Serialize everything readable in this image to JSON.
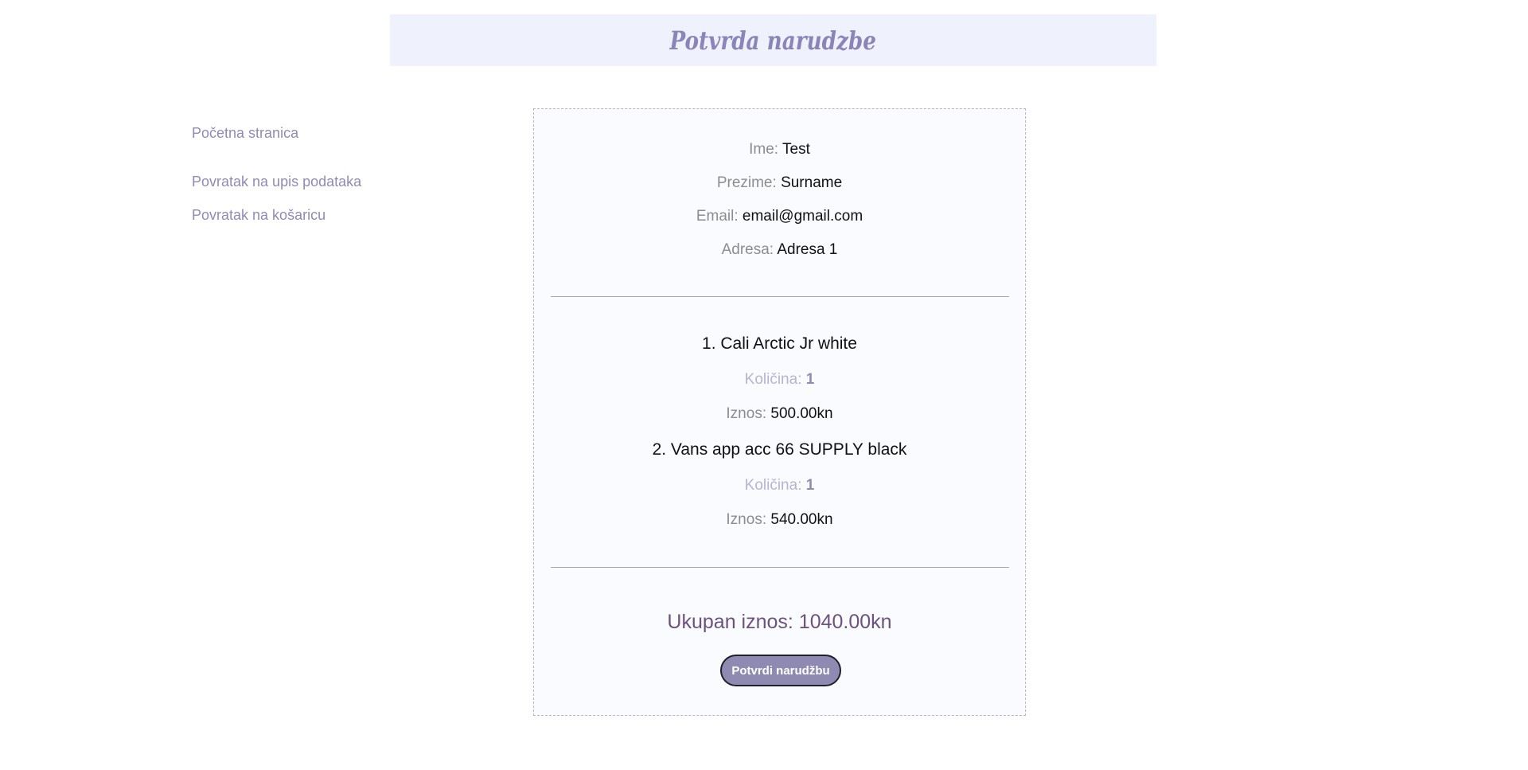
{
  "header": {
    "title": "Potvrda narudzbe"
  },
  "sidebar": {
    "items": [
      {
        "label": "Početna stranica"
      },
      {
        "label": "Povratak na upis podataka"
      },
      {
        "label": "Povratak na košaricu"
      }
    ]
  },
  "customer": {
    "name_label": "Ime:",
    "name_value": "Test",
    "surname_label": "Prezime:",
    "surname_value": "Surname",
    "email_label": "Email:",
    "email_value": "email@gmail.com",
    "address_label": "Adresa:",
    "address_value": "Adresa 1"
  },
  "items": [
    {
      "name": "1. Cali Arctic Jr white",
      "qty_label": "Količina:",
      "qty_value": "1",
      "amount_label": "Iznos:",
      "amount_value": "500.00kn"
    },
    {
      "name": "2. Vans app acc 66 SUPPLY black",
      "qty_label": "Količina:",
      "qty_value": "1",
      "amount_label": "Iznos:",
      "amount_value": "540.00kn"
    }
  ],
  "total": {
    "text": "Ukupan iznos: 1040.00kn"
  },
  "confirm_button": {
    "label": "Potvrdi narudžbu"
  },
  "colors": {
    "header_bg": "#eff1fd",
    "accent": "#8f8ab7",
    "total_text": "#6c5281",
    "button_bg": "#8f8ab2"
  }
}
